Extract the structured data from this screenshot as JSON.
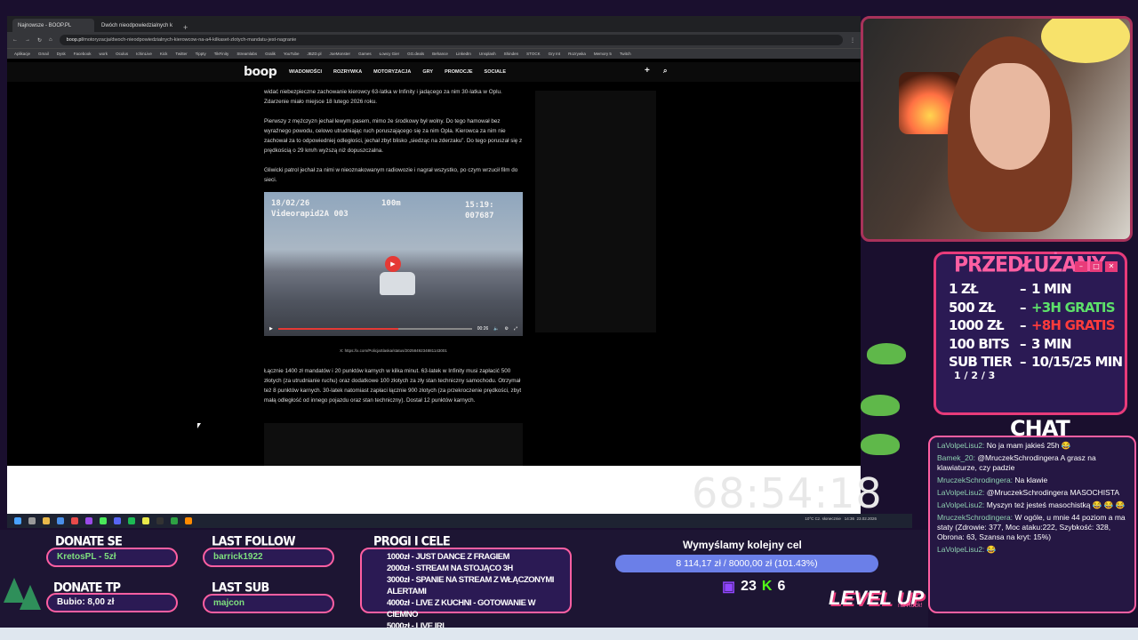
{
  "browser": {
    "tabs": [
      "Najnowsze - BOOP.PL",
      "Dwóch nieodpowiedzialnych k"
    ],
    "url_domain": "boop.pl",
    "url_path": "/motoryzacja/dwoch-nieodpowiedzialnych-kierowcow-na-a4-kilkaset-zlotych-mandatu-jest-nagranie",
    "bookmarks": [
      "Aplikacje",
      "Gmail",
      "Dysk",
      "Facebook",
      "work",
      "Oculus",
      "IchinLive",
      "Kick",
      "Twitter",
      "Tippty",
      "TikFinity",
      "Streamlabs",
      "Gralik",
      "YouTube",
      "JBZD.pl",
      "JoeMonster",
      "Games",
      "Łowcy Gier",
      "GG.deals",
      "Behance",
      "LinkedIn",
      "Unsplash",
      "Shinden",
      "STOCK",
      "Gry Int",
      "Rozrywka",
      "Memory 5",
      "Twitch"
    ]
  },
  "site": {
    "logo": "boop",
    "nav": [
      "WIADOMOŚCI",
      "ROZRYWKA",
      "MOTORYZACJA",
      "GRY",
      "PROMOCJE",
      "SOCIALE"
    ]
  },
  "article": {
    "p1": "widać niebezpieczne zachowanie kierowcy 63-latka w Infinity i jadącego za nim 30-latka w Oplu. Zdarzenie miało miejsce 18 lutego 2026 roku.",
    "p2": "Pierwszy z mężczyzn jechał lewym pasem, mimo że środkowy był wolny. Do tego hamował bez wyraźnego powodu, celowo utrudniając ruch poruszającego się za nim Opla. Kierowca za nim nie zachował za to odpowiedniej odległości, jechał zbyt blisko „siedząc na zderzaku”. Do tego poruszał się z prędkością o 29 km/h wyższą niż dopuszczalna.",
    "p3": "Gliwicki patrol jechał za nimi w nieoznakowanym radiowozie i nagrał wszystko, po czym wrzucił film do sieci.",
    "video": {
      "osd_date": "18/02/26",
      "osd_speed": "100m",
      "osd_time": "15:19:",
      "osd_id": "Videorapid2A 003",
      "osd_code": "007687",
      "time": "00:26",
      "progress": 0.62
    },
    "caption": "X: https://x.com/PolicjaSlaska/status/2025849234881143001",
    "p4": "Łącznie 1400 zł mandatów i 20 punktów karnych w kilka minut. 63-latek w Infinity musi zapłacić 500 złotych (za utrudnianie ruchu) oraz dodatkowe 100 złotych za zły stan techniczny samochodu. Otrzymał też 8 punktów karnych. 30-latek natomiast zapłaci łącznie 900 złotych (za przekroczenie prędkości, zbyt małą odległość od innego pojazdu oraz stan techniczny). Dostał 12 punktów karnych."
  },
  "timer": "68:54:18",
  "taskbar": {
    "weather": "10°C Cz. słonecznie",
    "clock": "14:36",
    "date": "23.02.2026"
  },
  "przedluzany": {
    "title": "PRZEDŁUŻANY",
    "rates": [
      {
        "left": "1 ZŁ",
        "right": "1 MIN",
        "color": "#ffffff"
      },
      {
        "left": "500 ZŁ",
        "right": "+3H GRATIS",
        "color": "#5de06a"
      },
      {
        "left": "1000 ZŁ",
        "right": "+8H GRATIS",
        "color": "#ff3b3b"
      },
      {
        "left": "100 BITS",
        "right": "3 MIN",
        "color": "#ffffff"
      },
      {
        "left": "SUB TIER",
        "right": "10/15/25 MIN",
        "color": "#ffffff"
      }
    ],
    "sub_tier_levels": "1 / 2 / 3"
  },
  "chat": {
    "title": "CHAT",
    "messages": [
      {
        "user": "LaVolpeLisu2:",
        "text": "No ja mam jakieś 25h 😂"
      },
      {
        "user": "Bamek_20:",
        "text": "@MruczekSchrodingera A grasz na klawiaturze, czy padzie"
      },
      {
        "user": "MruczekSchrodingera:",
        "text": "Na klawie"
      },
      {
        "user": "LaVolpeLisu2:",
        "text": "@MruczekSchrodingera MASOCHISTA"
      },
      {
        "user": "LaVolpeLisu2:",
        "text": "Myszyn też jesteś masochistką 😂 😂 😂"
      },
      {
        "user": "MruczekSchrodingera:",
        "text": "W ogóle, u mnie 44 poziom a ma staty (Zdrowie: 377, Moc ataku:222, Szybkość: 328, Obrona: 63, Szansa na kryt: 15%)"
      },
      {
        "user": "LaVolpeLisu2:",
        "text": "😂"
      }
    ]
  },
  "bottom": {
    "donate_title": "DONATE SE",
    "donate_value": "KretosPL - 5zł",
    "donate_tp_title": "DONATE TP",
    "donate_tp_value": "Bubio: 8,00 zł",
    "last_follow_title": "LAST FOLLOW",
    "last_follow_value": "barrick1922",
    "last_sub_title": "LAST SUB",
    "last_sub_value": "majcon",
    "progi_title": "PROGI I CELE",
    "progi": [
      "1000zł - JUST DANCE Z FRAGIEM",
      "2000zł - STREAM NA STOJĄCO 3H",
      "3000zł - SPANIE NA STREAM Z WŁĄCZONYMI ALERTAMI",
      "4000zł - LIVE Z KUCHNI - GOTOWANIE W CIEMNO",
      "5000zł - LIVE IRL"
    ],
    "goal_title": "Wymyślamy kolejny cel",
    "goal_amount": "8 114,17 zł / 8000,00 zł (101.43%)",
    "twitch_count": "23",
    "kick_count": "6",
    "levelup": "LEVEL UP",
    "levelup_sub": "na Rock!"
  }
}
